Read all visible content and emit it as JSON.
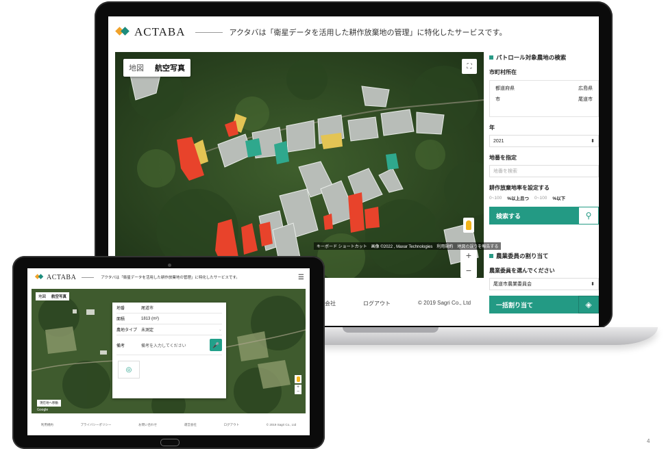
{
  "app": {
    "logo": "ACTABA",
    "tagline": "アクタバは「衛星データを活用した耕作放棄地の管理」に特化したサービスです。"
  },
  "map": {
    "tabs": [
      "地図",
      "航空写真"
    ],
    "active_tab": "航空写真",
    "zoom_in": "+",
    "zoom_out": "−",
    "fullscreen_icon": "fullscreen-icon",
    "attribution": "キーボード ショートカット　画像 ©2022 , Maxar Technologies　利用規約　地図の誤りを報告する"
  },
  "sidebar": {
    "search_title": "パトロール対象農地の検索",
    "municipality_label": "市町村所在",
    "prefecture_key": "都道府県",
    "prefecture_value": "広島県",
    "city_key": "市",
    "city_value": "尾道市",
    "year_label": "年",
    "year_value": "2021",
    "parcel_label": "地番を指定",
    "parcel_placeholder": "地番を検索",
    "rate_label": "耕作放棄地率を設定する",
    "rate_min_placeholder": "0~100",
    "rate_min_unit": "%以上且つ",
    "rate_max_placeholder": "0~100",
    "rate_max_unit": "%以下",
    "search_button": "検索する",
    "assign_title": "農業委員の割り当て",
    "assign_label": "農業委員を選んでください",
    "committee_value": "尾道市農業委員会",
    "bulk_assign_button": "一括割り当て"
  },
  "footer": {
    "company": "運営会社",
    "logout": "ログアウト",
    "copyright": "© 2019 Sagri Co., Ltd"
  },
  "tablet": {
    "logo": "ACTABA",
    "tagline": "アクタバは「衛星データを活用した耕作放棄地の管理」に特化したサービスです。",
    "menu_icon": "hamburger-icon",
    "map_tabs": [
      "地図",
      "航空写真"
    ],
    "popup": {
      "rows": [
        {
          "key": "地番",
          "value": "尾道市"
        },
        {
          "key": "面積",
          "value": "1813 (m²)"
        },
        {
          "key": "農地タイプ",
          "value": "未測定"
        }
      ],
      "memo_key": "備考",
      "memo_placeholder": "備考を入力してください"
    },
    "move_button": "現在地へ移動",
    "google": "Google",
    "footer_links": [
      "利用規約",
      "プライバシーポリシー",
      "お問い合わせ",
      "運営会社",
      "ログアウト",
      "© 2019 Sagri Co., Ltd"
    ]
  },
  "page_number": "4",
  "colors": {
    "brand_green": "#239a84",
    "logo_orange": "#f0a22a",
    "parcel_red": "#e8432b",
    "parcel_yellow": "#e3c454",
    "parcel_teal": "#2fa88d"
  }
}
